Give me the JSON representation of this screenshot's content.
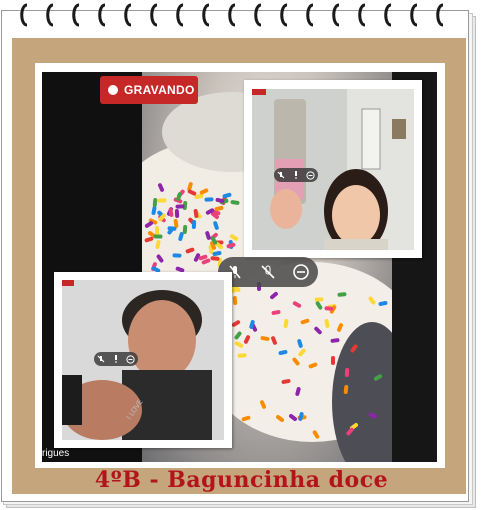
{
  "recording": {
    "label": "GRAVANDO",
    "color": "#c62828"
  },
  "participant_name": "rigues",
  "caption": {
    "text": "4ºB - Baguncinha doce",
    "color": "#b3141b"
  },
  "main_controls": {
    "icons": [
      "mic-off-icon",
      "video-off-icon",
      "remove-icon"
    ]
  },
  "thumbnail_controls": {
    "icons": [
      "mic-off-icon",
      "mic-icon",
      "remove-icon"
    ]
  },
  "frame_colors": {
    "tan": "#c4a57c",
    "page": "#ffffff"
  }
}
